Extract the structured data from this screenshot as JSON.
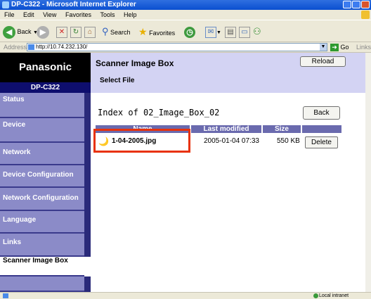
{
  "window": {
    "title": "DP-C322 - Microsoft Internet Explorer"
  },
  "menu": [
    "File",
    "Edit",
    "View",
    "Favorites",
    "Tools",
    "Help"
  ],
  "toolbar": {
    "back_label": "Back",
    "search_label": "Search",
    "favorites_label": "Favorites"
  },
  "address": {
    "label": "Address",
    "url": "http://10.74.232.130/",
    "go_label": "Go",
    "links_label": "Links"
  },
  "nav": {
    "brand": "Panasonic",
    "model": "DP-C322",
    "items": [
      {
        "label": "Status"
      },
      {
        "label": "Device"
      },
      {
        "label": "Network"
      },
      {
        "label": "Device Configuration"
      },
      {
        "label": "Network Configuration"
      },
      {
        "label": "Language"
      },
      {
        "label": "Links"
      },
      {
        "label": "Scanner Image Box"
      }
    ]
  },
  "header": {
    "title": "Scanner Image Box",
    "subtitle": "Select File",
    "reload_label": "Reload"
  },
  "listing": {
    "title": "Index of 02_Image_Box_02",
    "back_label": "Back",
    "columns": [
      "Name",
      "Last modified",
      "Size"
    ],
    "rows": [
      {
        "name": "1-04-2005.jpg",
        "modified": "2005-01-04 07:33",
        "size": "550 KB",
        "action": "Delete"
      }
    ]
  },
  "status": {
    "zone": "Local intranet"
  },
  "colors": {
    "highlight": "#e8320c",
    "nav_bg": "#8b8bc8",
    "header_bg": "#d3d3f3",
    "table_head": "#6a6aae"
  }
}
